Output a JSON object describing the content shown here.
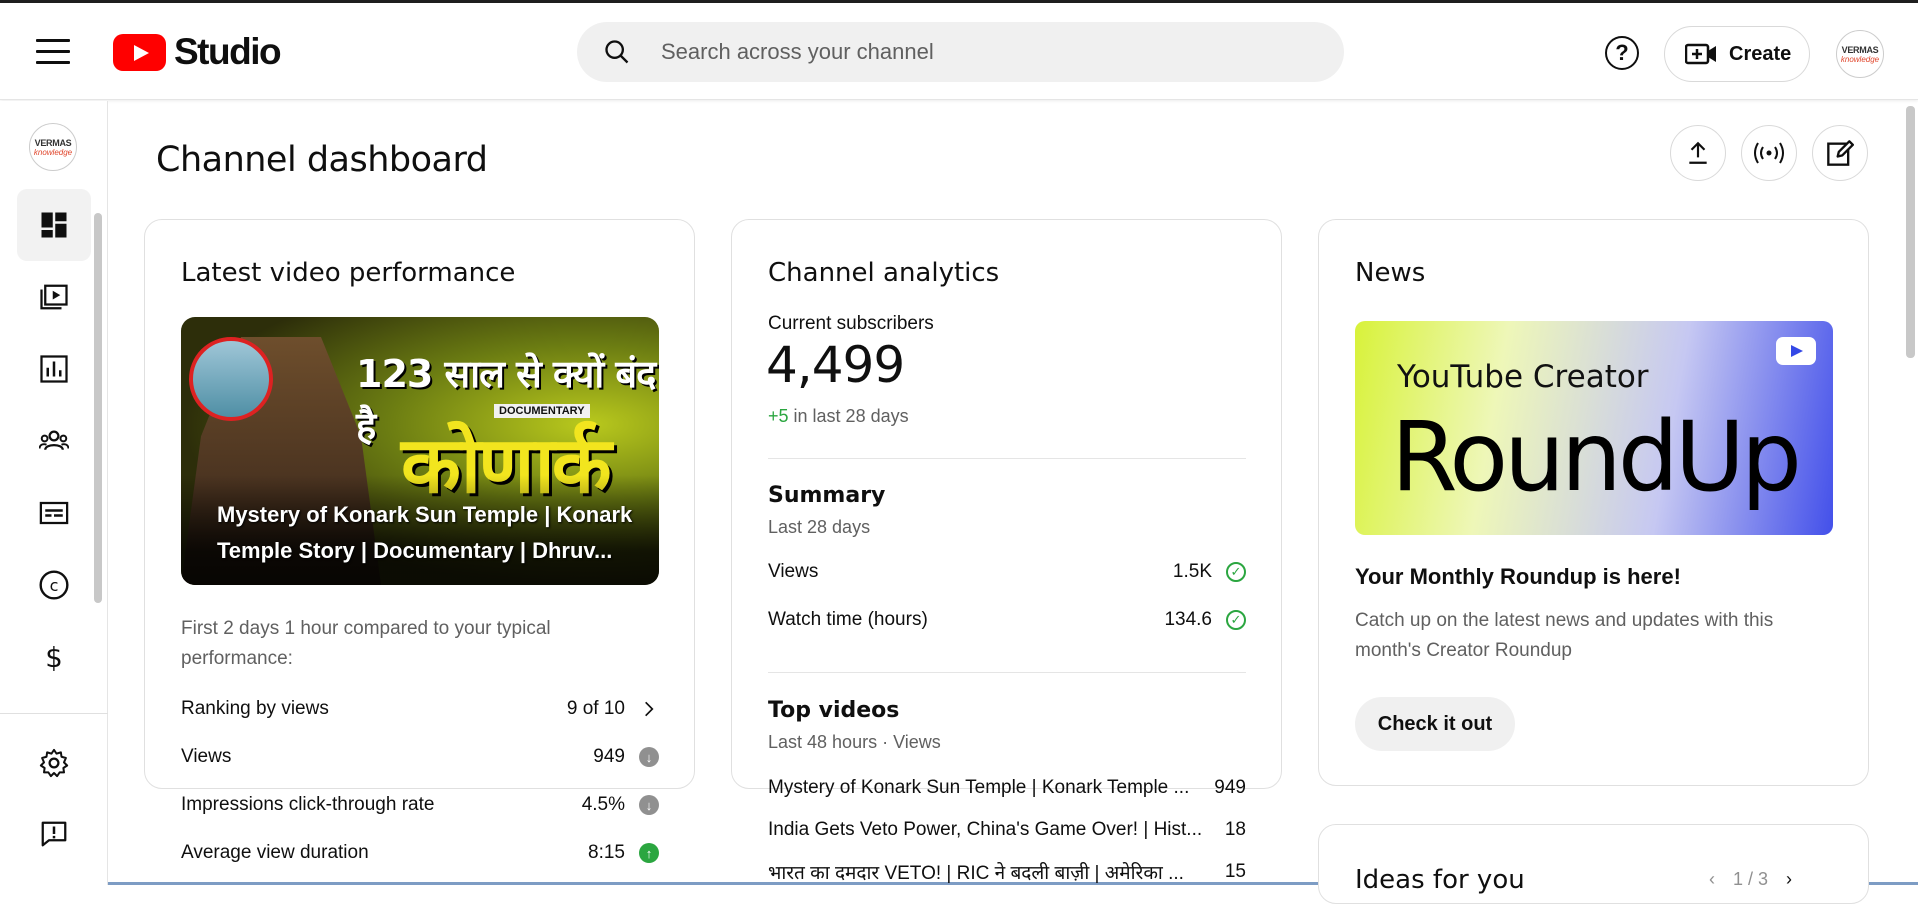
{
  "app": {
    "brand": "Studio",
    "search_placeholder": "Search across your channel",
    "create_label": "Create",
    "avatar_line1": "VERMAS",
    "avatar_line2": "knowledge"
  },
  "sidebar": {
    "items": [
      {
        "name": "dashboard",
        "icon": "dashboard-icon"
      },
      {
        "name": "content",
        "icon": "content-icon"
      },
      {
        "name": "analytics",
        "icon": "analytics-icon"
      },
      {
        "name": "community",
        "icon": "community-icon"
      },
      {
        "name": "subtitles",
        "icon": "subtitles-icon"
      },
      {
        "name": "copyright",
        "icon": "copyright-icon"
      },
      {
        "name": "earn",
        "icon": "dollar-icon"
      },
      {
        "name": "settings",
        "icon": "gear-icon"
      },
      {
        "name": "feedback",
        "icon": "feedback-icon"
      }
    ]
  },
  "page": {
    "title": "Channel dashboard"
  },
  "latest_video": {
    "card_title": "Latest video performance",
    "thumb_top_text": "123 साल से क्यों बंद है",
    "thumb_tag": "DOCUMENTARY",
    "thumb_big_text": "कोणार्क",
    "video_title": "Mystery of Konark Sun Temple | Konark Temple Story | Documentary | Dhruv...",
    "note": "First 2 days 1 hour compared to your typical performance:",
    "metrics": [
      {
        "label": "Ranking by views",
        "value": "9 of 10"
      },
      {
        "label": "Views",
        "value": "949"
      },
      {
        "label": "Impressions click-through rate",
        "value": "4.5%"
      },
      {
        "label": "Average view duration",
        "value": "8:15"
      }
    ]
  },
  "analytics": {
    "card_title": "Channel analytics",
    "subs_label": "Current subscribers",
    "subs_count": "4,499",
    "subs_delta": "+5",
    "subs_delta_suffix": " in last 28 days",
    "summary_title": "Summary",
    "summary_period": "Last 28 days",
    "summary_rows": [
      {
        "label": "Views",
        "value": "1.5K"
      },
      {
        "label": "Watch time (hours)",
        "value": "134.6"
      }
    ],
    "top_title": "Top videos",
    "top_period": "Last 48 hours · Views",
    "top_videos": [
      {
        "title": "Mystery of Konark Sun Temple | Konark Temple ...",
        "views": "949"
      },
      {
        "title": "India Gets Veto Power, China's Game Over! | Hist...",
        "views": "18"
      },
      {
        "title": "भारत का दमदार VETO! | RIC ने बदली बाज़ी | अमेरिका ...",
        "views": "15"
      }
    ]
  },
  "news": {
    "card_title": "News",
    "banner_line1": "YouTube Creator",
    "banner_line2": "RoundUp",
    "headline": "Your Monthly Roundup is here!",
    "body": "Catch up on the latest news and updates with this month's Creator Roundup",
    "cta": "Check it out"
  },
  "ideas": {
    "title": "Ideas for you",
    "pager": "1 / 3"
  },
  "colors": {
    "accent_red": "#ff0000",
    "positive_green": "#2ba640",
    "neutral_gray": "#909090"
  }
}
